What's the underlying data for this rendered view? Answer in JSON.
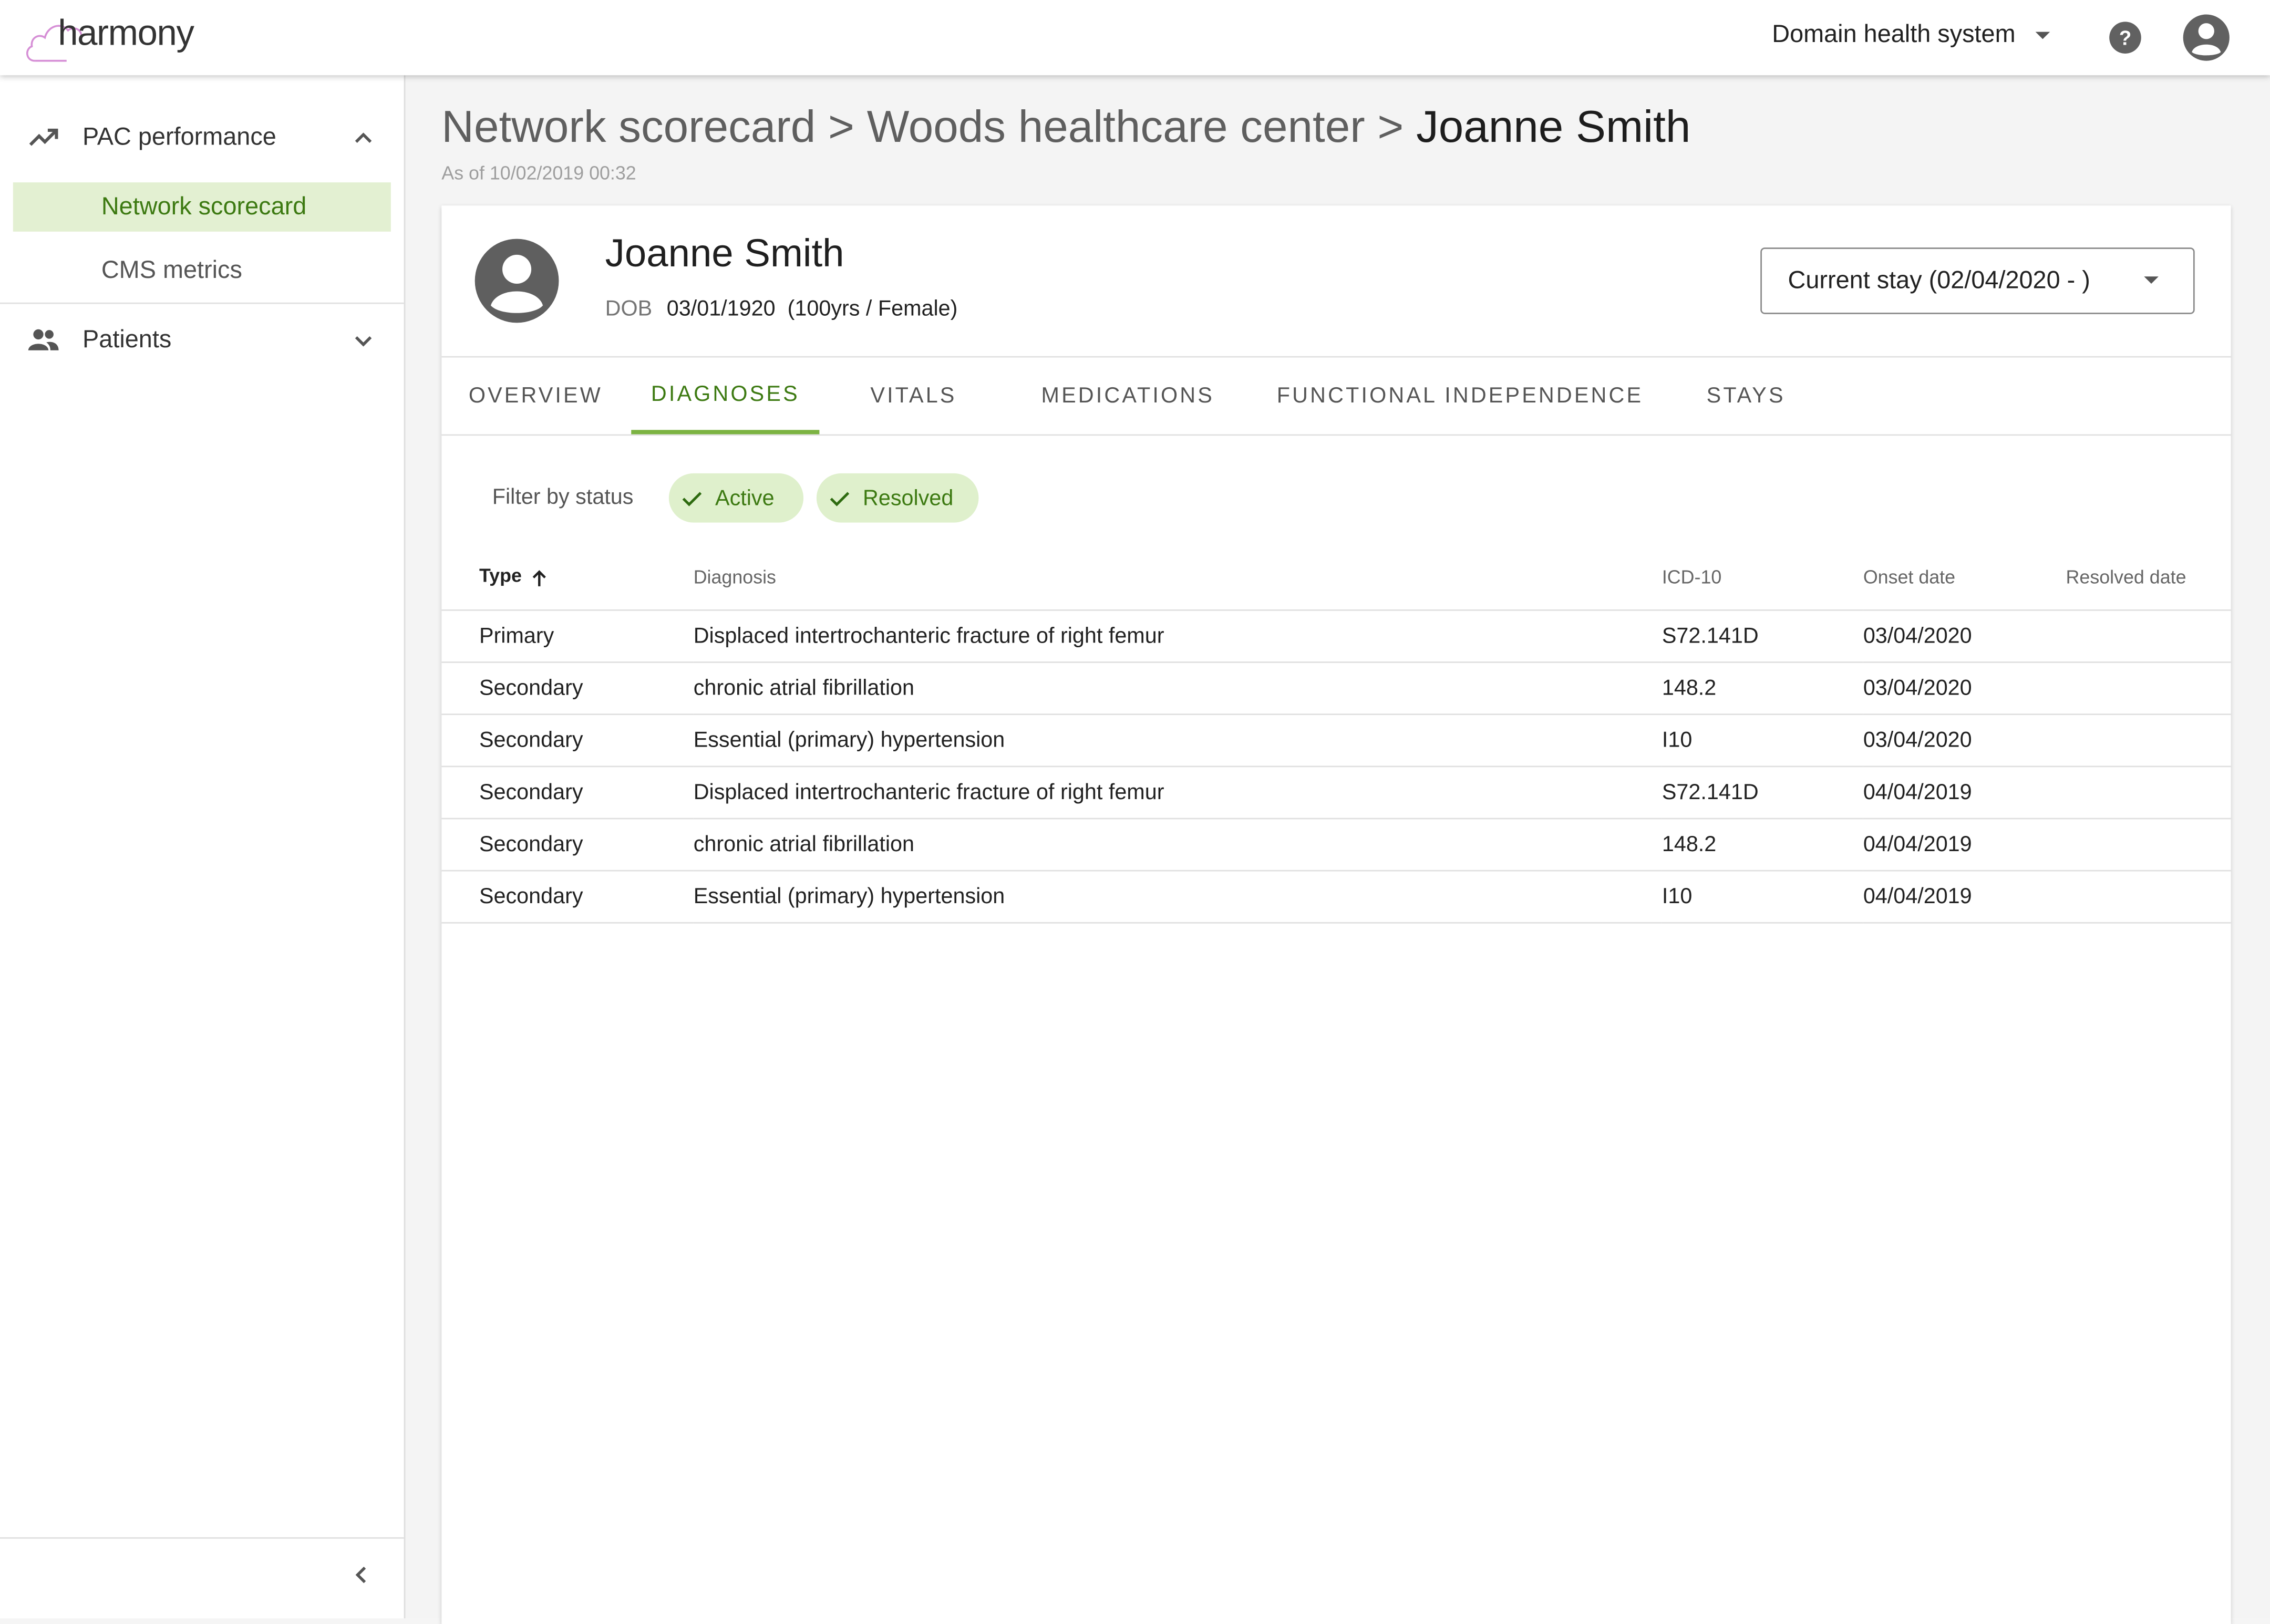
{
  "header": {
    "logo_text": "harmony",
    "org_selector": "Domain health system",
    "help_icon": "help-circle-icon",
    "account_icon": "account-circle-icon"
  },
  "sidebar": {
    "groups": [
      {
        "label": "PAC performance",
        "icon": "trending-up-icon",
        "expanded": true,
        "items": [
          {
            "label": "Network scorecard",
            "active": true
          },
          {
            "label": "CMS metrics",
            "active": false
          }
        ]
      },
      {
        "label": "Patients",
        "icon": "people-icon",
        "expanded": false,
        "items": []
      }
    ],
    "collapse_icon": "chevron-left-icon"
  },
  "page": {
    "breadcrumb": [
      "Network scorecard",
      "Woods healthcare center",
      "Joanne Smith"
    ],
    "separator": ">",
    "as_of": "As of 10/02/2019 00:32"
  },
  "patient": {
    "name": "Joanne Smith",
    "dob_label": "DOB",
    "dob": "03/01/1920",
    "age_sex": "(100yrs / Female)",
    "stay_select": "Current stay (02/04/2020 - )"
  },
  "tabs": [
    "OVERVIEW",
    "DIAGNOSES",
    "VITALS",
    "MEDICATIONS",
    "FUNCTIONAL INDEPENDENCE",
    "STAYS"
  ],
  "active_tab": "DIAGNOSES",
  "filter": {
    "label": "Filter by status",
    "chips": [
      "Active",
      "Resolved"
    ]
  },
  "table": {
    "columns": [
      "Type",
      "Diagnosis",
      "ICD-10",
      "Onset date",
      "Resolved date"
    ],
    "sort_column": "Type",
    "sort_direction": "ascending",
    "rows": [
      [
        "Primary",
        "Displaced intertrochanteric fracture of right femur",
        "S72.141D",
        "03/04/2020",
        ""
      ],
      [
        "Secondary",
        "chronic atrial fibrillation",
        "148.2",
        "03/04/2020",
        ""
      ],
      [
        "Secondary",
        "Essential (primary) hypertension",
        "I10",
        "03/04/2020",
        ""
      ],
      [
        "Secondary",
        "Displaced intertrochanteric fracture of right femur",
        "S72.141D",
        "04/04/2019",
        ""
      ],
      [
        "Secondary",
        "chronic atrial fibrillation",
        "148.2",
        "04/04/2019",
        ""
      ],
      [
        "Secondary",
        "Essential (primary) hypertension",
        "I10",
        "04/04/2019",
        ""
      ]
    ]
  },
  "colors": {
    "accent_green": "#3d7a12",
    "active_nav_bg": "#e3f0d2",
    "chip_bg": "#dff0cc",
    "tab_indicator": "#7cb342",
    "logo_cloud": "#d68fd6"
  }
}
